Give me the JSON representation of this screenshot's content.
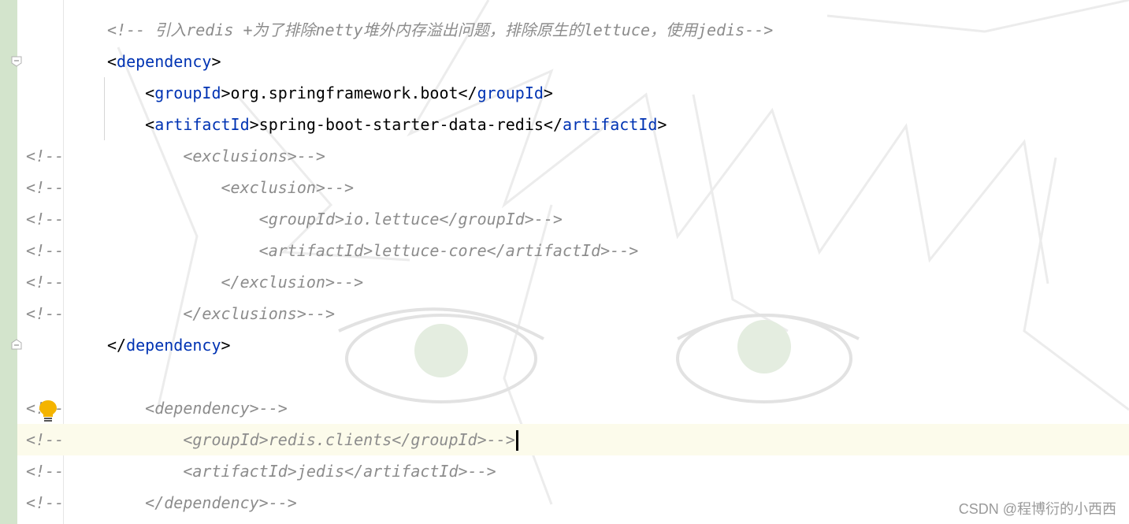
{
  "editor": {
    "lines": [
      {
        "indent": "",
        "text": "<!-- 引入redis +为了排除netty堆外内存溢出问题，排除原生的lettuce，使用jedis-->"
      },
      {
        "indent": "",
        "open": "<",
        "tag": "dependency",
        "close": ">"
      },
      {
        "indent": "    ",
        "open": "<",
        "tag": "groupId",
        "mid": ">org.springframework.boot</",
        "tag2": "groupId",
        "close": ">"
      },
      {
        "indent": "    ",
        "open": "<",
        "tag": "artifactId",
        "mid": ">spring-boot-starter-data-redis</",
        "tag2": "artifactId",
        "close": ">"
      },
      {
        "indent": "        ",
        "text": "<exclusions>-->"
      },
      {
        "indent": "            ",
        "text": "<exclusion>-->"
      },
      {
        "indent": "                ",
        "text": "<groupId>io.lettuce</groupId>-->"
      },
      {
        "indent": "                ",
        "text": "<artifactId>lettuce-core</artifactId>-->"
      },
      {
        "indent": "            ",
        "text": "</exclusion>-->"
      },
      {
        "indent": "        ",
        "text": "</exclusions>-->"
      },
      {
        "indent": "",
        "open": "</",
        "tag": "dependency",
        "close": ">"
      },
      {
        "indent": "",
        "text": ""
      },
      {
        "indent": "    ",
        "text": "<dependency>-->"
      },
      {
        "indent": "        ",
        "text": "<groupId>redis.clients</groupId>-->"
      },
      {
        "indent": "        ",
        "text": "<artifactId>jedis</artifactId>-->"
      },
      {
        "indent": "    ",
        "text": "</dependency>-->"
      }
    ],
    "comment_marker": "<!--",
    "caret_line": 14
  },
  "watermark": {
    "credit": "CSDN @程博衍的小西西"
  },
  "icons": {
    "intention": "lightbulb-icon",
    "fold_open": "fold-open-icon",
    "fold_close": "fold-close-icon"
  },
  "colors": {
    "tag": "#0033b3",
    "comment": "#8c8c8c",
    "text": "#000000",
    "gutter_vcs": "#d3e4cc",
    "current_line": "#fcfbeb",
    "bulb": "#f4b400"
  }
}
